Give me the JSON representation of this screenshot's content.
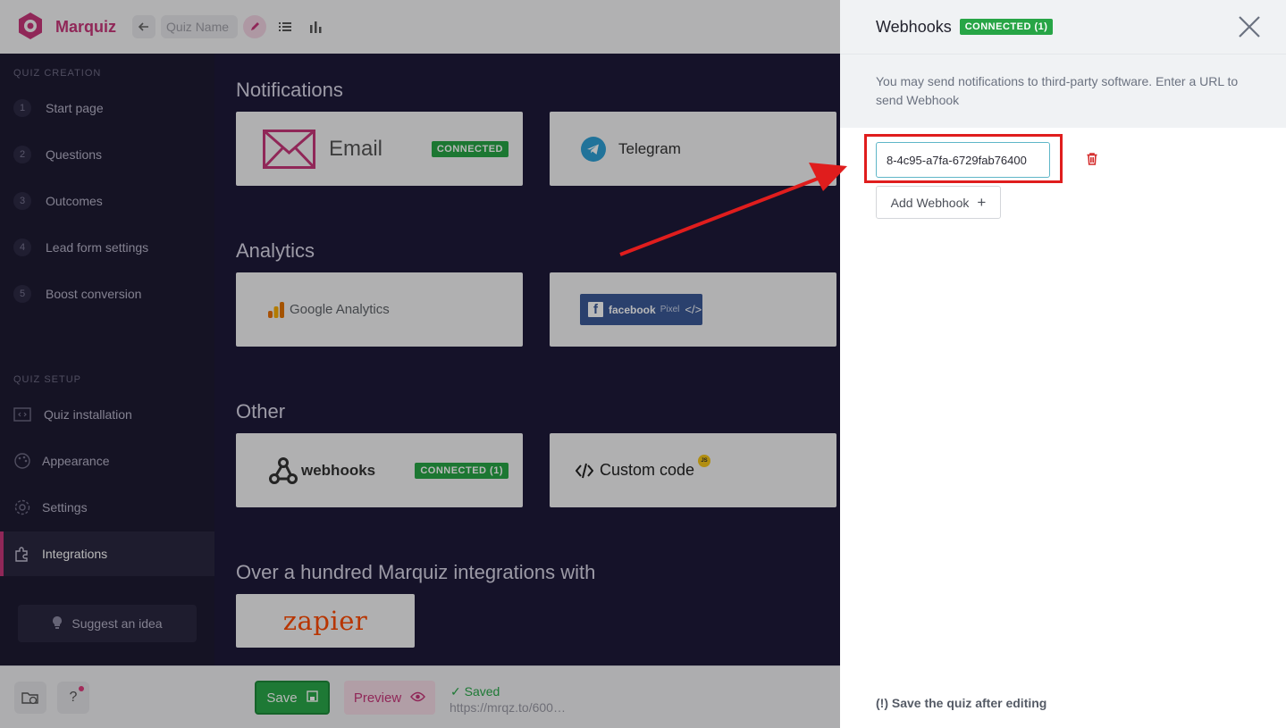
{
  "header": {
    "brand": "Marquiz",
    "quiz_name_placeholder": "Quiz Name"
  },
  "sidebar": {
    "creation_label": "QUIZ CREATION",
    "steps": [
      {
        "num": "1",
        "label": "Start page"
      },
      {
        "num": "2",
        "label": "Questions"
      },
      {
        "num": "3",
        "label": "Outcomes"
      },
      {
        "num": "4",
        "label": "Lead form settings"
      },
      {
        "num": "5",
        "label": "Boost conversion"
      }
    ],
    "setup_label": "QUIZ SETUP",
    "setup_items": [
      {
        "label": "Quiz installation",
        "icon": "code-window-icon"
      },
      {
        "label": "Appearance",
        "icon": "palette-icon"
      },
      {
        "label": "Settings",
        "icon": "gear-icon"
      },
      {
        "label": "Integrations",
        "icon": "puzzle-icon"
      }
    ],
    "active_item": "Integrations",
    "suggest_label": "Suggest an idea"
  },
  "main": {
    "notifications_title": "Notifications",
    "email_label": "Email",
    "email_badge": "CONNECTED",
    "telegram_label": "Telegram",
    "analytics_title": "Analytics",
    "google_analytics_label": "Google Analytics",
    "facebook_label": "facebook",
    "facebook_pixel": "Pixel",
    "facebook_code": "</>",
    "other_title": "Other",
    "webhooks_label": "webhooks",
    "webhooks_badge": "CONNECTED (1)",
    "custom_code_label": "Custom code",
    "custom_code_badge": "JS",
    "integrations_title": "Over a hundred Marquiz integrations with",
    "zapier_label": "zapier"
  },
  "footer": {
    "save_label": "Save",
    "preview_label": "Preview",
    "saved_label": "✓ Saved",
    "saved_url": "https://mrqz.to/600…"
  },
  "drawer": {
    "title": "Webhooks",
    "badge": "CONNECTED (1)",
    "description": "You may send notifications to third-party software. Enter a URL to send Webhook",
    "webhook_url": "8-4c95-a7fa-6729fab76400",
    "add_label": "Add Webhook",
    "save_note": "(!) Save the quiz after editing"
  },
  "colors": {
    "brand": "#c8377a",
    "connected": "#27a546",
    "annotation": "#e01d1d"
  }
}
